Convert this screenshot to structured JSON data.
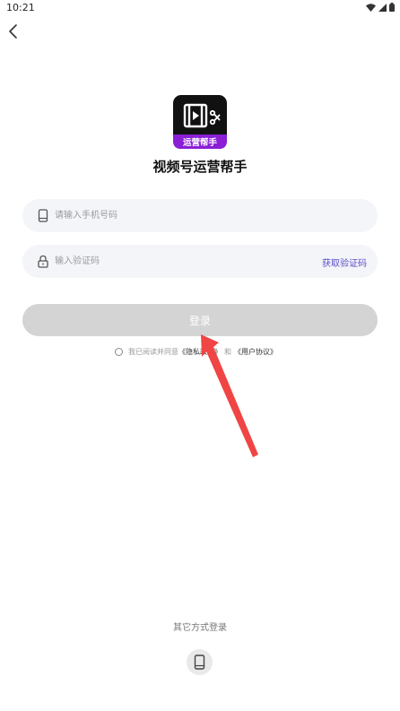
{
  "status_bar": {
    "time": "10:21"
  },
  "app": {
    "name": "视频号运营帮手",
    "logo_text": "运营帮手"
  },
  "form": {
    "phone_placeholder": "请输入手机号码",
    "code_placeholder": "输入验证码",
    "get_code_label": "获取验证码",
    "login_label": "登录"
  },
  "agreement": {
    "prefix": "我已阅读并同意",
    "privacy_link": "《隐私政策》",
    "conjunction": "和",
    "user_link": "《用户协议》"
  },
  "other_login": {
    "label": "其它方式登录"
  },
  "colors": {
    "accent": "#5a4ec9",
    "logo_bg": "#111111",
    "logo_band": "#8a1fd6",
    "button_disabled": "#d4d4d4",
    "annotation_arrow": "#f04545"
  }
}
